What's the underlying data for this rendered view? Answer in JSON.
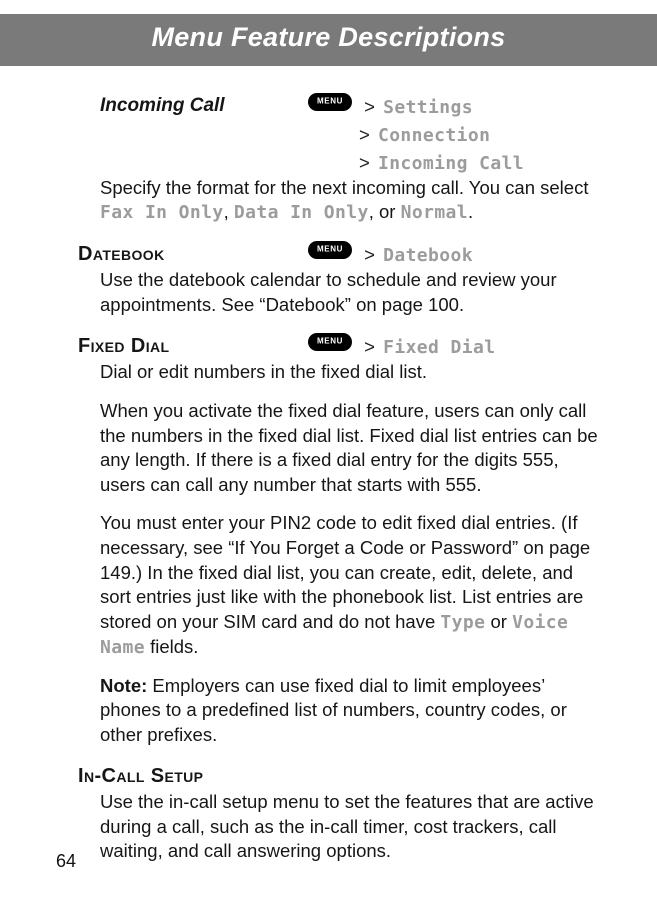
{
  "header": {
    "title": "Menu Feature Descriptions"
  },
  "sections": {
    "incoming": {
      "title": "Incoming Call",
      "path1": "Settings",
      "path2": "Connection",
      "path3": "Incoming Call",
      "body1_a": "Specify the format for the next incoming call. You can select ",
      "opt1": "Fax In Only",
      "sep1": ", ",
      "opt2": "Data In Only",
      "sep2": ", or ",
      "opt3": "Normal",
      "body1_b": "."
    },
    "datebook": {
      "title": "Datebook",
      "path1": "Datebook",
      "body1": "Use the datebook calendar to schedule and review your appointments. See “Datebook” on page 100."
    },
    "fixed": {
      "title": "Fixed Dial",
      "path1": "Fixed Dial",
      "body1": "Dial or edit numbers in the fixed dial list.",
      "body2": "When you activate the fixed dial feature, users can only call the numbers in the fixed dial list. Fixed dial list entries can be any length. If there is a fixed dial entry for the digits 555, users can call any number that starts with 555.",
      "body3_a": "You must enter your PIN2 code to edit fixed dial entries. (If necessary, see “If You Forget a Code or Password” on page 149.) In the fixed dial list, you can create, edit, delete, and sort entries just like with the phonebook list. List entries are stored on your SIM card and do not have ",
      "mono1": "Type",
      "body3_b": " or ",
      "mono2": "Voice Name",
      "body3_c": " fields.",
      "note_label": "Note:",
      "note": " Employers can use fixed dial to limit employees’ phones to a predefined list of numbers, country codes, or other prefixes."
    },
    "incall": {
      "title": "In-Call Setup",
      "body1": "Use the in-call setup menu to set the features that are active during a call, such as the in-call timer, cost trackers, call waiting, and call answering options."
    }
  },
  "gt": ">",
  "page_number": "64"
}
